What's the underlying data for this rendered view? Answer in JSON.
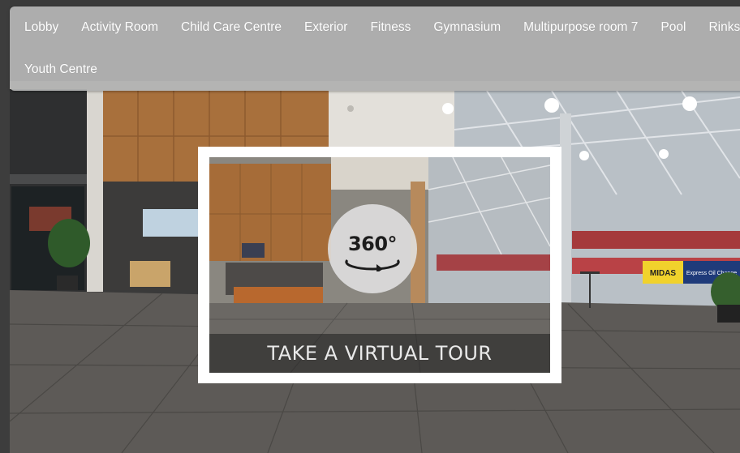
{
  "nav": {
    "rooms": [
      "Lobby",
      "Activity Room",
      "Child Care Centre",
      "Exterior",
      "Fitness",
      "Gymnasium",
      "Multipurpose room 7",
      "Pool",
      "Rinks"
    ],
    "rooms_row2": [
      "Youth Centre"
    ]
  },
  "tour": {
    "badge": "360°",
    "cta": "TAKE A VIRTUAL TOUR"
  },
  "scene": {
    "rink_sign": "MIDAS",
    "rink_sign_2": "Express Oil Change"
  },
  "colors": {
    "nav_bg": "#b2b2b2",
    "nav_text": "#ffffff",
    "wood": "#a8703c",
    "floor": "#5d5a57"
  }
}
